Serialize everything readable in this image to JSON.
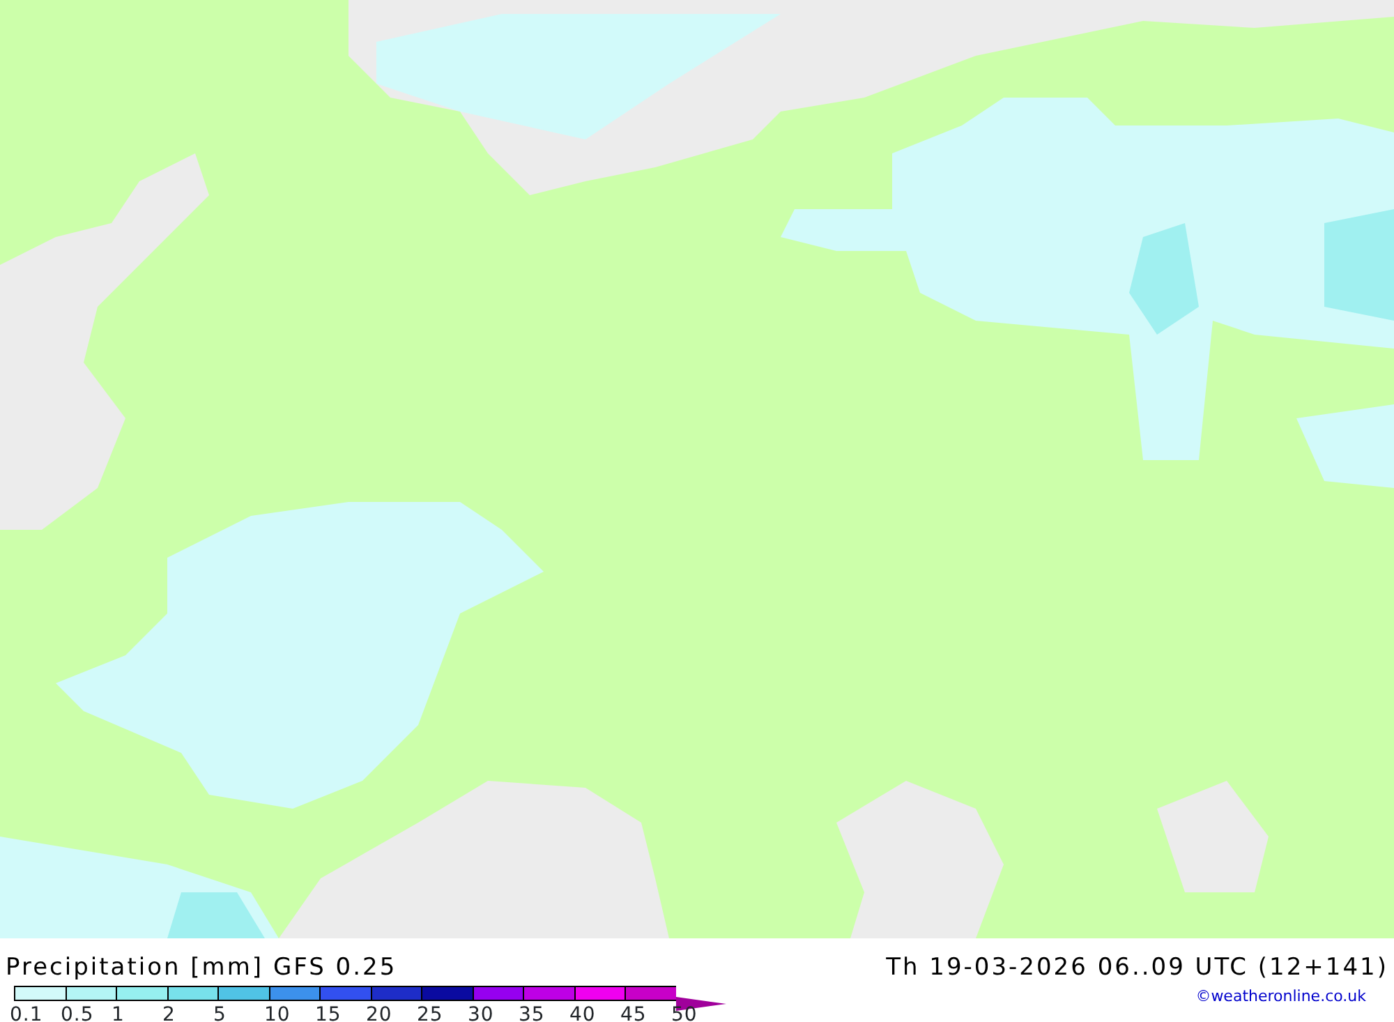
{
  "map": {
    "title": "Precipitation [mm] GFS 0.25",
    "valid_time": "Th 19-03-2026 06..09 UTC (12+141)"
  },
  "legend": [
    {
      "label": "0.1",
      "color": "#d2fafa",
      "kind": "box"
    },
    {
      "label": "0.5",
      "color": "#b4f5f5",
      "kind": "box"
    },
    {
      "label": "1",
      "color": "#96f0f0",
      "kind": "box"
    },
    {
      "label": "2",
      "color": "#78e1eb",
      "kind": "box"
    },
    {
      "label": "5",
      "color": "#50c3e6",
      "kind": "box"
    },
    {
      "label": "10",
      "color": "#3c91ec",
      "kind": "box"
    },
    {
      "label": "15",
      "color": "#3250f0",
      "kind": "box"
    },
    {
      "label": "20",
      "color": "#1e2dc8",
      "kind": "box"
    },
    {
      "label": "25",
      "color": "#0a0aa0",
      "kind": "box"
    },
    {
      "label": "30",
      "color": "#9600f0",
      "kind": "box"
    },
    {
      "label": "35",
      "color": "#be00e6",
      "kind": "box"
    },
    {
      "label": "40",
      "color": "#f000f0",
      "kind": "box"
    },
    {
      "label": "45",
      "color": "#c800c8",
      "kind": "box"
    },
    {
      "label": "50",
      "color": "#a0009b",
      "kind": "arrow"
    }
  ],
  "credit": "©weatheronline.co.uk"
}
